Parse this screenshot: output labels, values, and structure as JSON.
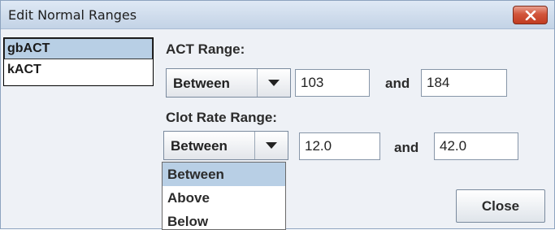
{
  "window": {
    "title": "Edit Normal Ranges"
  },
  "assay_list": {
    "items": [
      "gbACT",
      "kACT"
    ],
    "selected": "gbACT"
  },
  "act_range": {
    "label": "ACT Range:",
    "mode": "Between",
    "low": "103",
    "and_label": "and",
    "high": "184"
  },
  "clot_rate_range": {
    "label": "Clot Rate Range:",
    "mode": "Between",
    "low": "12.0",
    "and_label": "and",
    "high": "42.0"
  },
  "dropdown": {
    "options": [
      "Between",
      "Above",
      "Below"
    ],
    "highlighted": "Between"
  },
  "buttons": {
    "close": "Close"
  },
  "icons": {
    "close": "close-icon",
    "combo_arrow": "chevron-down-icon"
  },
  "colors": {
    "selection": "#b8cfe5",
    "close_button": "#c13d22"
  }
}
